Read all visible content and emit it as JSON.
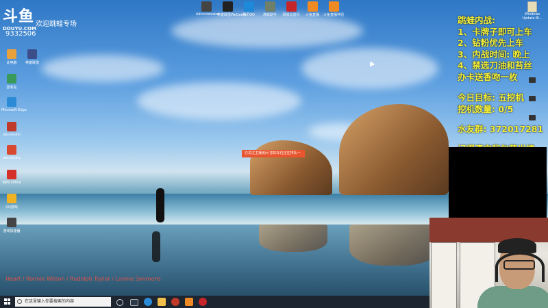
{
  "stream": {
    "logo": "斗鱼",
    "logo_sub": "DOUYU.COM",
    "room_name": "跳蛙专场",
    "room_prefix": "欢迎",
    "viewer_count": "9332506"
  },
  "overlay": {
    "lines": [
      "跳蛙内战:",
      "1、卡牌子即可上车",
      "2、钻粉优先上车",
      "3、内战时间: 晚上",
      "4、禁选刀油和苔丝",
      "办卡送香吻一枚"
    ],
    "target_lines": [
      "今日目标: 五挖机",
      "挖机数量: 0/5"
    ],
    "qq_group": "水友群: 372017281",
    "bottom_note": "记得清空背包荧光棒"
  },
  "popup": {
    "text": "已关注主播房间    您的车位还在排队一"
  },
  "song": {
    "text": "Heart / Ronnie Wilson / Rudolph Taylor / Lonnie Simmons"
  },
  "desktop_icons_left": [
    {
      "label": "此电脑",
      "color": "#e9a23b"
    },
    {
      "label": "英雄联盟",
      "color": "#3b4e8a"
    },
    {
      "label": "回收站",
      "color": "#3a9a5b"
    },
    {
      "label": "Microsoft Edge",
      "color": "#2b8bd6"
    },
    {
      "label": "obs-studio",
      "color": "#c03a2b"
    },
    {
      "label": "obs-studio",
      "color": "#d8482f"
    },
    {
      "label": "WPS Office",
      "color": "#d6302b"
    },
    {
      "label": "QQ游戏",
      "color": "#f0b323"
    },
    {
      "label": "游戏加速器",
      "color": "#444444"
    }
  ],
  "desktop_icons_top": [
    {
      "label": "Administrator",
      "color": "#444444"
    },
    {
      "label": "英雄联盟WeGame",
      "color": "#222222"
    },
    {
      "label": "腾讯QQ",
      "color": "#1d89d8"
    },
    {
      "label": "游戏助手",
      "color": "#6e7f6a"
    },
    {
      "label": "网易云音乐",
      "color": "#c6252a"
    },
    {
      "label": "斗鱼直播",
      "color": "#f08a24"
    },
    {
      "label": "斗鱼直播伴侣",
      "color": "#f08a24"
    }
  ],
  "windows_update": {
    "label": "Windows Update Bl..."
  },
  "taskbar": {
    "search_placeholder": "在这里输入你要搜索的内容",
    "colors": {
      "bg": "#1c2530"
    }
  }
}
